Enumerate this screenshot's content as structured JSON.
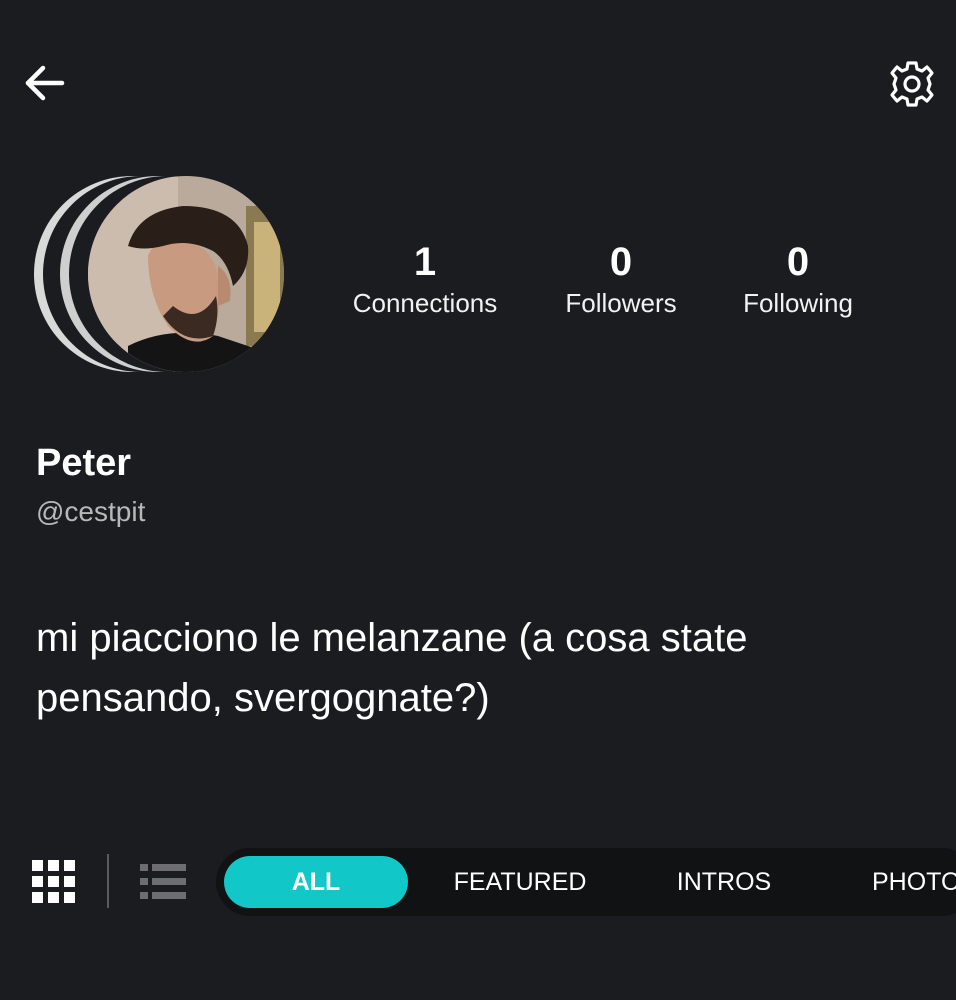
{
  "header": {
    "back_icon": "arrow-left-icon",
    "settings_icon": "gear-icon"
  },
  "profile": {
    "display_name": "Peter",
    "username": "@cestpit",
    "bio": "mi piacciono le melanzane (a cosa state pensando, svergognate?)"
  },
  "stats": {
    "connections": {
      "value": "1",
      "label": "Connections"
    },
    "followers": {
      "value": "0",
      "label": "Followers"
    },
    "following": {
      "value": "0",
      "label": "Following"
    }
  },
  "filters": {
    "grid_icon": "grid-view-icon",
    "list_icon": "list-view-icon",
    "tabs": [
      "ALL",
      "FEATURED",
      "INTROS",
      "PHOTOS"
    ],
    "active_tab": "ALL"
  },
  "colors": {
    "background": "#1b1c1f",
    "accent": "#12c7c7",
    "tab_bar": "#111214"
  }
}
